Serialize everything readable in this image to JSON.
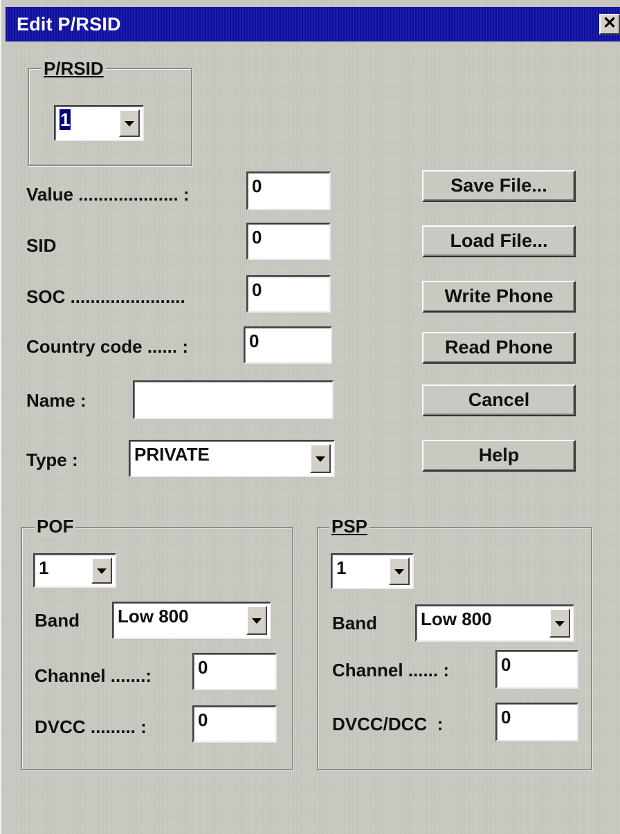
{
  "window": {
    "title": "Edit P/RSID",
    "close_glyph": "✕"
  },
  "prsid_group": {
    "title": "P/RSID",
    "combo_value": "1"
  },
  "fields": {
    "value": {
      "label": "Value .................... :",
      "value": "0"
    },
    "sid": {
      "label": "SID",
      "value": "0"
    },
    "soc": {
      "label": "SOC .......................",
      "value": "0"
    },
    "country_code": {
      "label": "Country code ...... :",
      "value": "0"
    },
    "name": {
      "label": "Name :",
      "value": ""
    },
    "type": {
      "label": "Type :",
      "value": "PRIVATE"
    }
  },
  "buttons": {
    "save_file": "Save File...",
    "load_file": "Load File...",
    "write_phone": "Write Phone",
    "read_phone": "Read Phone",
    "cancel": "Cancel",
    "help": "Help"
  },
  "pof_group": {
    "title": "POF",
    "combo_value": "1",
    "band_label": "Band",
    "band_value": "Low 800",
    "channel_label": "Channel .......:",
    "channel_value": "0",
    "dvcc_label": "DVCC ......... :",
    "dvcc_value": "0"
  },
  "psp_group": {
    "title": "PSP",
    "combo_value": "1",
    "band_label": "Band",
    "band_value": "Low 800",
    "channel_label": "Channel ...... :",
    "channel_value": "0",
    "dvcc_label": "DVCC/DCC  :",
    "dvcc_value": "0"
  },
  "colors": {
    "title_bar": "#1414a0",
    "dialog_bg": "#c9c9c1",
    "selection": "#000080"
  }
}
